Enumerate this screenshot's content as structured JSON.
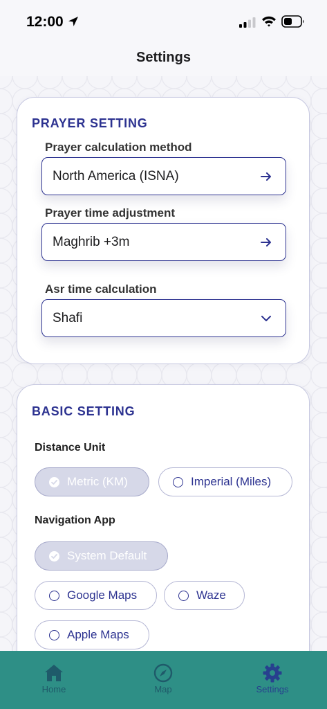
{
  "status": {
    "time": "12:00",
    "icons": [
      "location-arrow-icon",
      "signal-icon",
      "wifi-icon",
      "battery-icon"
    ]
  },
  "header": {
    "title": "Settings"
  },
  "prayer": {
    "title": "PRAYER SETTING",
    "calc_label": "Prayer calculation method",
    "calc_value": "North America (ISNA)",
    "adjust_label": "Prayer time adjustment",
    "adjust_value": "Maghrib +3m",
    "asr_label": "Asr time calculation",
    "asr_value": "Shafi"
  },
  "basic": {
    "title": "BASIC SETTING",
    "distance_label": "Distance Unit",
    "distance_options": [
      {
        "label": "Metric (KM)",
        "selected": true
      },
      {
        "label": "Imperial (Miles)",
        "selected": false
      }
    ],
    "nav_label": "Navigation App",
    "nav_options": [
      {
        "label": "System Default",
        "selected": true
      },
      {
        "label": "Google Maps",
        "selected": false
      },
      {
        "label": "Waze",
        "selected": false
      },
      {
        "label": "Apple Maps",
        "selected": false
      }
    ]
  },
  "tabs": [
    {
      "label": "Home",
      "icon": "home-icon",
      "active": false
    },
    {
      "label": "Map",
      "icon": "compass-icon",
      "active": false
    },
    {
      "label": "Settings",
      "icon": "gear-icon",
      "active": true
    }
  ],
  "colors": {
    "accent": "#2c3290",
    "tab_bar": "#2e8f86",
    "active_tab": "#27408e",
    "selected_chip": "#d6d8e8"
  }
}
